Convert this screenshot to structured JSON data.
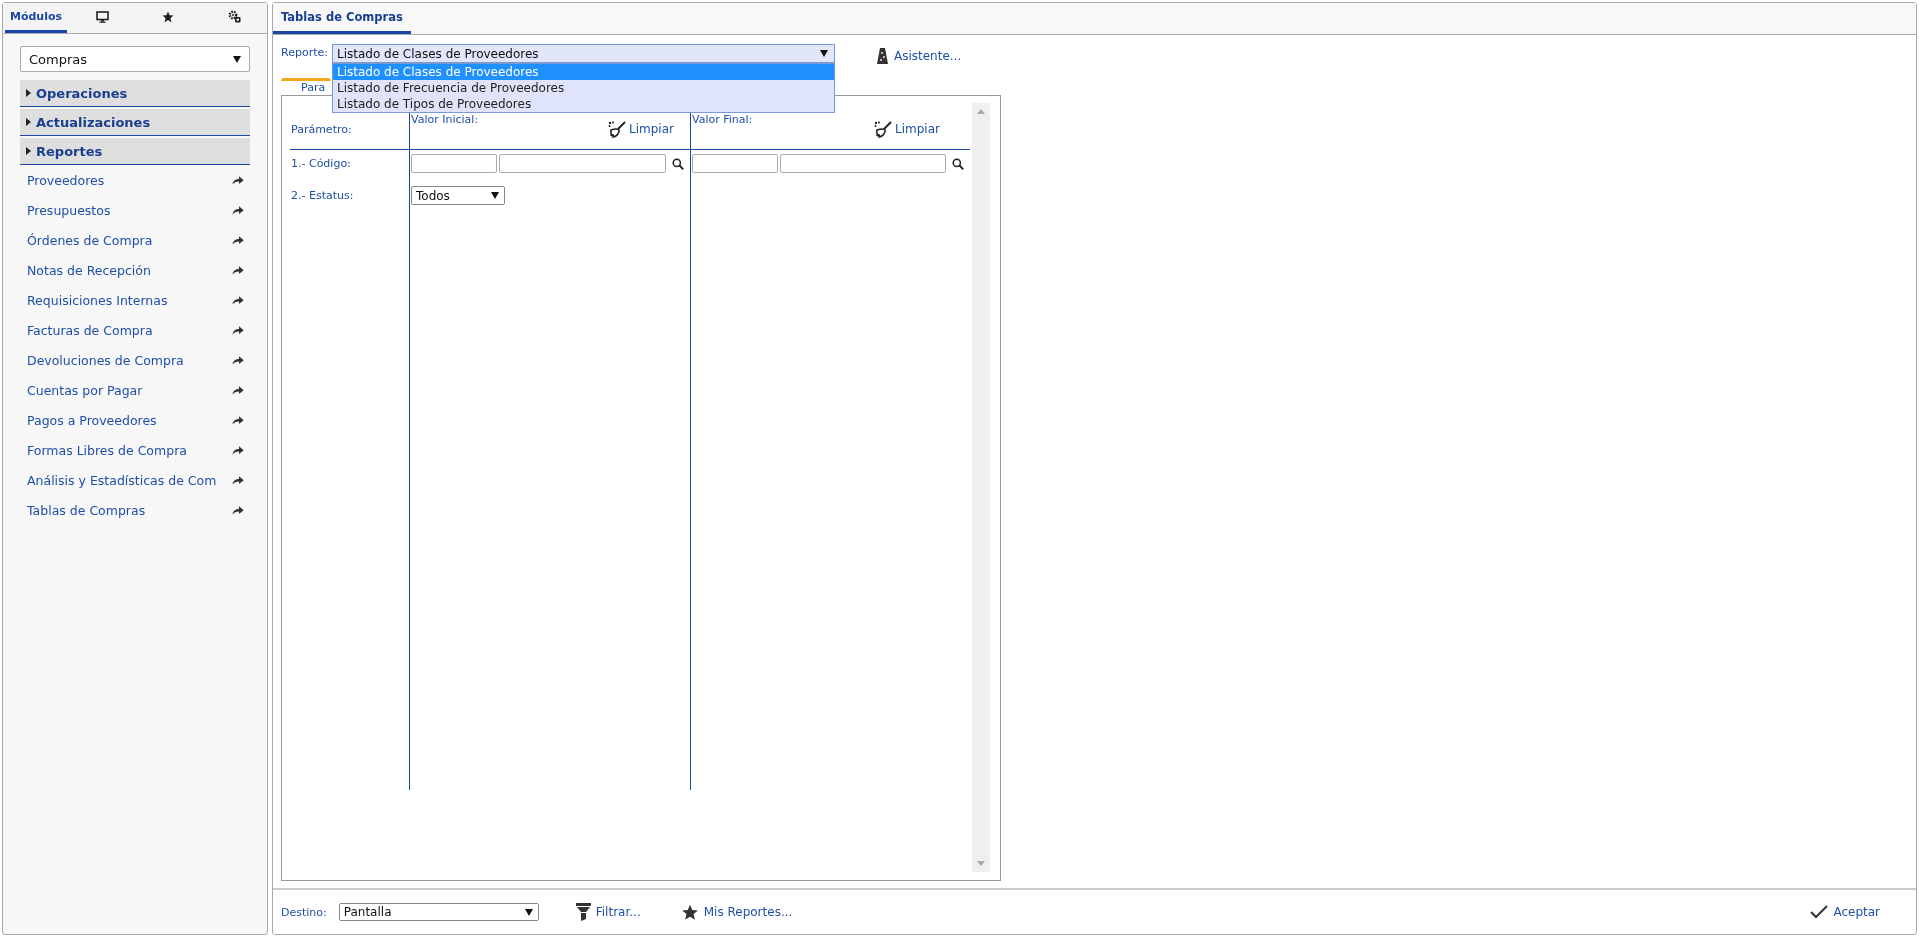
{
  "sidebar": {
    "tabs": [
      {
        "kind": "text",
        "label": "Módulos",
        "selected": true
      },
      {
        "kind": "monitor",
        "selected": false
      },
      {
        "kind": "star",
        "selected": false
      },
      {
        "kind": "gears",
        "selected": false
      }
    ],
    "module_select": {
      "value": "Compras"
    },
    "sections": [
      {
        "label": "Operaciones",
        "expanded": false
      },
      {
        "label": "Actualizaciones",
        "expanded": false
      },
      {
        "label": "Reportes",
        "expanded": false
      }
    ],
    "items": [
      {
        "label": "Proveedores"
      },
      {
        "label": "Presupuestos"
      },
      {
        "label": "Órdenes de Compra"
      },
      {
        "label": "Notas de Recepción"
      },
      {
        "label": "Requisiciones Internas"
      },
      {
        "label": "Facturas de Compra"
      },
      {
        "label": "Devoluciones de Compra"
      },
      {
        "label": "Cuentas por Pagar"
      },
      {
        "label": "Pagos a Proveedores"
      },
      {
        "label": "Formas Libres de Compra"
      },
      {
        "label": "Análisis y Estadísticas de Com"
      },
      {
        "label": "Tablas de Compras"
      }
    ]
  },
  "main": {
    "tabs": [
      {
        "label": "Tablas de Compras",
        "selected": true
      }
    ],
    "report": {
      "label": "Reporte:",
      "value": "Listado de Clases de Proveedores",
      "options": [
        {
          "label": "Listado de Clases de Proveedores",
          "selected": true
        },
        {
          "label": "Listado de Frecuencia de Proveedores",
          "selected": false
        },
        {
          "label": "Listado de Tipos de Proveedores",
          "selected": false
        }
      ]
    },
    "assistant": "Asistente...",
    "param_tabs": [
      {
        "label": "Para",
        "selected": true
      }
    ],
    "param_table": {
      "parameter_header": "Parámetro:",
      "initial_header": "Valor Inicial:",
      "initial_clear": "Limpiar",
      "final_header": "Valor Final:",
      "final_clear": "Limpiar",
      "rows": [
        {
          "label": "1.- Código:",
          "kind": "lookup"
        },
        {
          "label": "2.- Estatus:",
          "kind": "select",
          "value": "Todos"
        }
      ]
    }
  },
  "footer": {
    "destination_label": "Destino:",
    "destination_value": "Pantalla",
    "filter": "Filtrar...",
    "my_reports": "Mis Reportes...",
    "accept": "Aceptar"
  }
}
